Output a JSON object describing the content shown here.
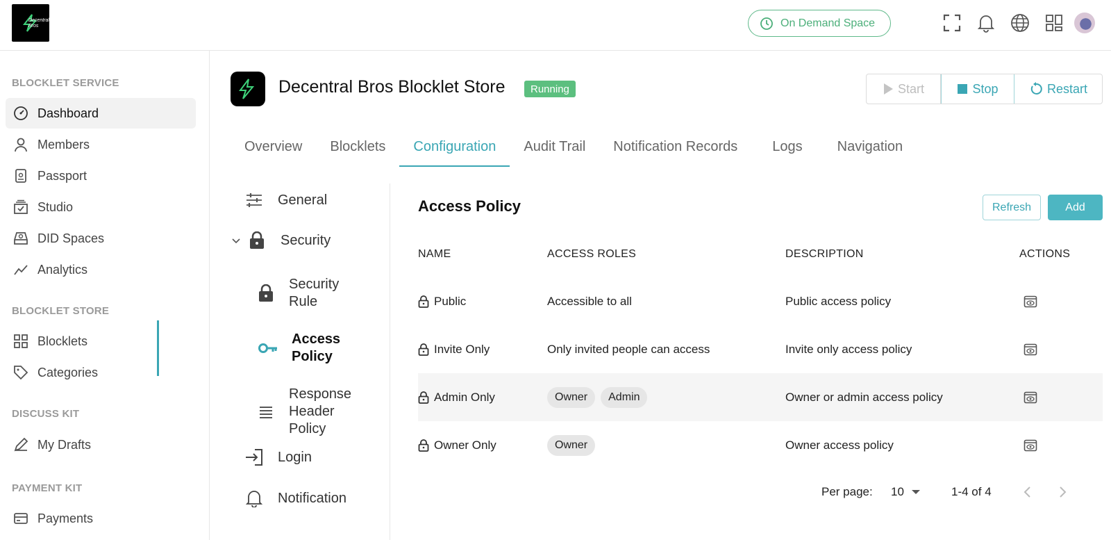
{
  "topbar": {
    "logo_text": "Decentral Bros",
    "on_demand_label": "On Demand Space"
  },
  "sidebar": {
    "groups": [
      {
        "title": "BLOCKLET SERVICE",
        "items": [
          {
            "label": "Dashboard",
            "icon": "dashboard-gauge-icon"
          },
          {
            "label": "Members",
            "icon": "user-icon"
          },
          {
            "label": "Passport",
            "icon": "passport-icon"
          },
          {
            "label": "Studio",
            "icon": "studio-icon"
          },
          {
            "label": "DID Spaces",
            "icon": "did-spaces-icon"
          },
          {
            "label": "Analytics",
            "icon": "analytics-icon"
          }
        ]
      },
      {
        "title": "BLOCKLET STORE",
        "items": [
          {
            "label": "Blocklets",
            "icon": "grid-icon"
          },
          {
            "label": "Categories",
            "icon": "tag-icon"
          }
        ]
      },
      {
        "title": "DISCUSS KIT",
        "items": [
          {
            "label": "My Drafts",
            "icon": "pen-icon"
          }
        ]
      },
      {
        "title": "PAYMENT KIT",
        "items": [
          {
            "label": "Payments",
            "icon": "card-icon"
          }
        ]
      }
    ]
  },
  "app": {
    "title": "Decentral Bros Blocklet Store",
    "status": "Running",
    "actions": {
      "start": "Start",
      "stop": "Stop",
      "restart": "Restart"
    }
  },
  "tabs": [
    "Overview",
    "Blocklets",
    "Configuration",
    "Audit Trail",
    "Notification Records",
    "Logs",
    "Navigation"
  ],
  "active_tab": "Configuration",
  "config_nav": {
    "general": "General",
    "security": "Security",
    "security_rule": "Security Rule",
    "access_policy": "Access Policy",
    "response_header_policy": "Response Header Policy",
    "login": "Login",
    "notification": "Notification"
  },
  "panel": {
    "title": "Access Policy",
    "refresh": "Refresh",
    "add": "Add",
    "columns": {
      "name": "NAME",
      "roles": "ACCESS ROLES",
      "description": "DESCRIPTION",
      "actions": "ACTIONS"
    },
    "rows": [
      {
        "name": "Public",
        "roles_text": "Accessible to all",
        "roles": [],
        "description": "Public access policy"
      },
      {
        "name": "Invite Only",
        "roles_text": "Only invited people can access",
        "roles": [],
        "description": "Invite only access policy"
      },
      {
        "name": "Admin Only",
        "roles_text": "",
        "roles": [
          "Owner",
          "Admin"
        ],
        "description": "Owner or admin access policy"
      },
      {
        "name": "Owner Only",
        "roles_text": "",
        "roles": [
          "Owner"
        ],
        "description": "Owner access policy"
      }
    ],
    "pagination": {
      "per_page_label": "Per page:",
      "per_page": "10",
      "range": "1-4 of 4"
    }
  },
  "colors": {
    "accent": "#3aa6b4",
    "running": "#5cbf7f",
    "on_demand": "#4caf7a"
  }
}
